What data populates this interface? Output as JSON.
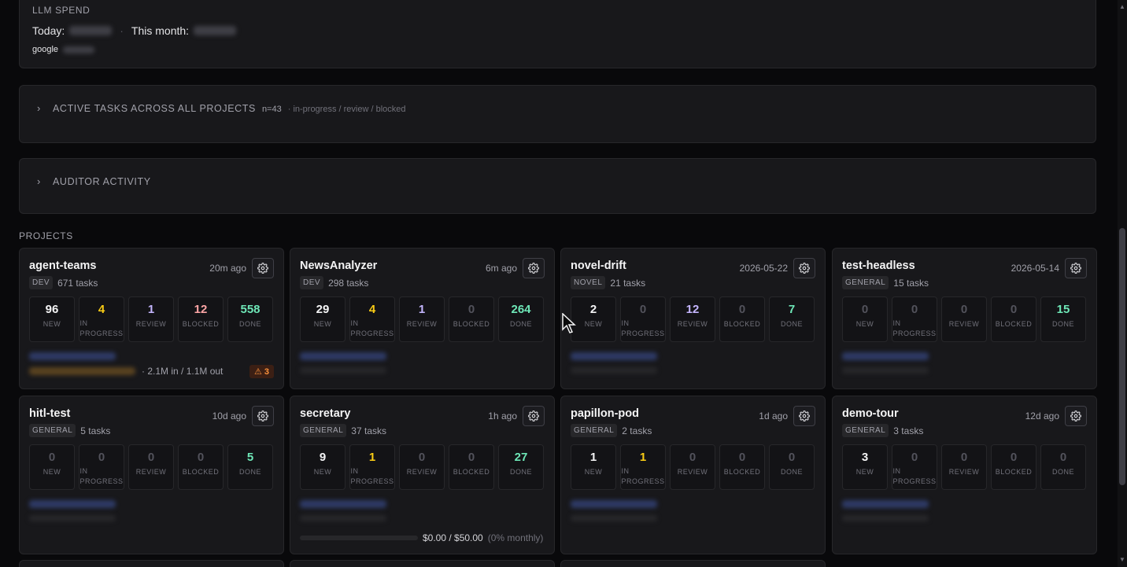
{
  "llm_spend": {
    "label": "LLM SPEND",
    "today_label": "Today:",
    "month_label": "This month:",
    "provider": "google"
  },
  "active_tasks": {
    "title": "ACTIVE TASKS ACROSS ALL PROJECTS",
    "count": "n=43",
    "statuses": "· in-progress / review / blocked"
  },
  "auditor": {
    "title": "AUDITOR ACTIVITY"
  },
  "projects_title": "PROJECTS",
  "stat_labels": {
    "new": "NEW",
    "in_progress": "IN PROGRESS",
    "review": "REVIEW",
    "blocked": "BLOCKED",
    "done": "DONE"
  },
  "projects": [
    {
      "name": "agent-teams",
      "ago": "20m ago",
      "tag": "DEV",
      "tasks": "671 tasks",
      "stats": {
        "new": "96",
        "in_progress": "4",
        "review": "1",
        "blocked": "12",
        "done": "558"
      },
      "tokens": "2.1M in / 1.1M out",
      "warnings": "⚠ 3"
    },
    {
      "name": "NewsAnalyzer",
      "ago": "6m ago",
      "tag": "DEV",
      "tasks": "298 tasks",
      "stats": {
        "new": "29",
        "in_progress": "4",
        "review": "1",
        "blocked": "0",
        "done": "264"
      }
    },
    {
      "name": "novel-drift",
      "ago": "2026-05-22",
      "tag": "NOVEL",
      "tasks": "21 tasks",
      "stats": {
        "new": "2",
        "in_progress": "0",
        "review": "12",
        "blocked": "0",
        "done": "7"
      }
    },
    {
      "name": "test-headless",
      "ago": "2026-05-14",
      "tag": "GENERAL",
      "tasks": "15 tasks",
      "stats": {
        "new": "0",
        "in_progress": "0",
        "review": "0",
        "blocked": "0",
        "done": "15"
      }
    },
    {
      "name": "hitl-test",
      "ago": "10d ago",
      "tag": "GENERAL",
      "tasks": "5 tasks",
      "stats": {
        "new": "0",
        "in_progress": "0",
        "review": "0",
        "blocked": "0",
        "done": "5"
      }
    },
    {
      "name": "secretary",
      "ago": "1h ago",
      "tag": "GENERAL",
      "tasks": "37 tasks",
      "stats": {
        "new": "9",
        "in_progress": "1",
        "review": "0",
        "blocked": "0",
        "done": "27"
      },
      "budget": {
        "text": "$0.00 / $50.00",
        "pct": "(0% monthly)",
        "fraction": 0
      }
    },
    {
      "name": "papillon-pod",
      "ago": "1d ago",
      "tag": "GENERAL",
      "tasks": "2 tasks",
      "stats": {
        "new": "1",
        "in_progress": "1",
        "review": "0",
        "blocked": "0",
        "done": "0"
      }
    },
    {
      "name": "demo-tour",
      "ago": "12d ago",
      "tag": "GENERAL",
      "tasks": "3 tasks",
      "stats": {
        "new": "3",
        "in_progress": "0",
        "review": "0",
        "blocked": "0",
        "done": "0"
      }
    }
  ],
  "icons": {
    "gear": "gear-icon",
    "chevron": "chevron-right-icon",
    "warning": "warning-icon",
    "cursor": "mouse-cursor-icon"
  },
  "colors": {
    "background": "#09090b",
    "panel": "#18181b",
    "in_progress": "#facc15",
    "review": "#c4b5fd",
    "blocked": "#fca5a5",
    "done": "#6ee7b7",
    "warning": "#fb923c"
  }
}
